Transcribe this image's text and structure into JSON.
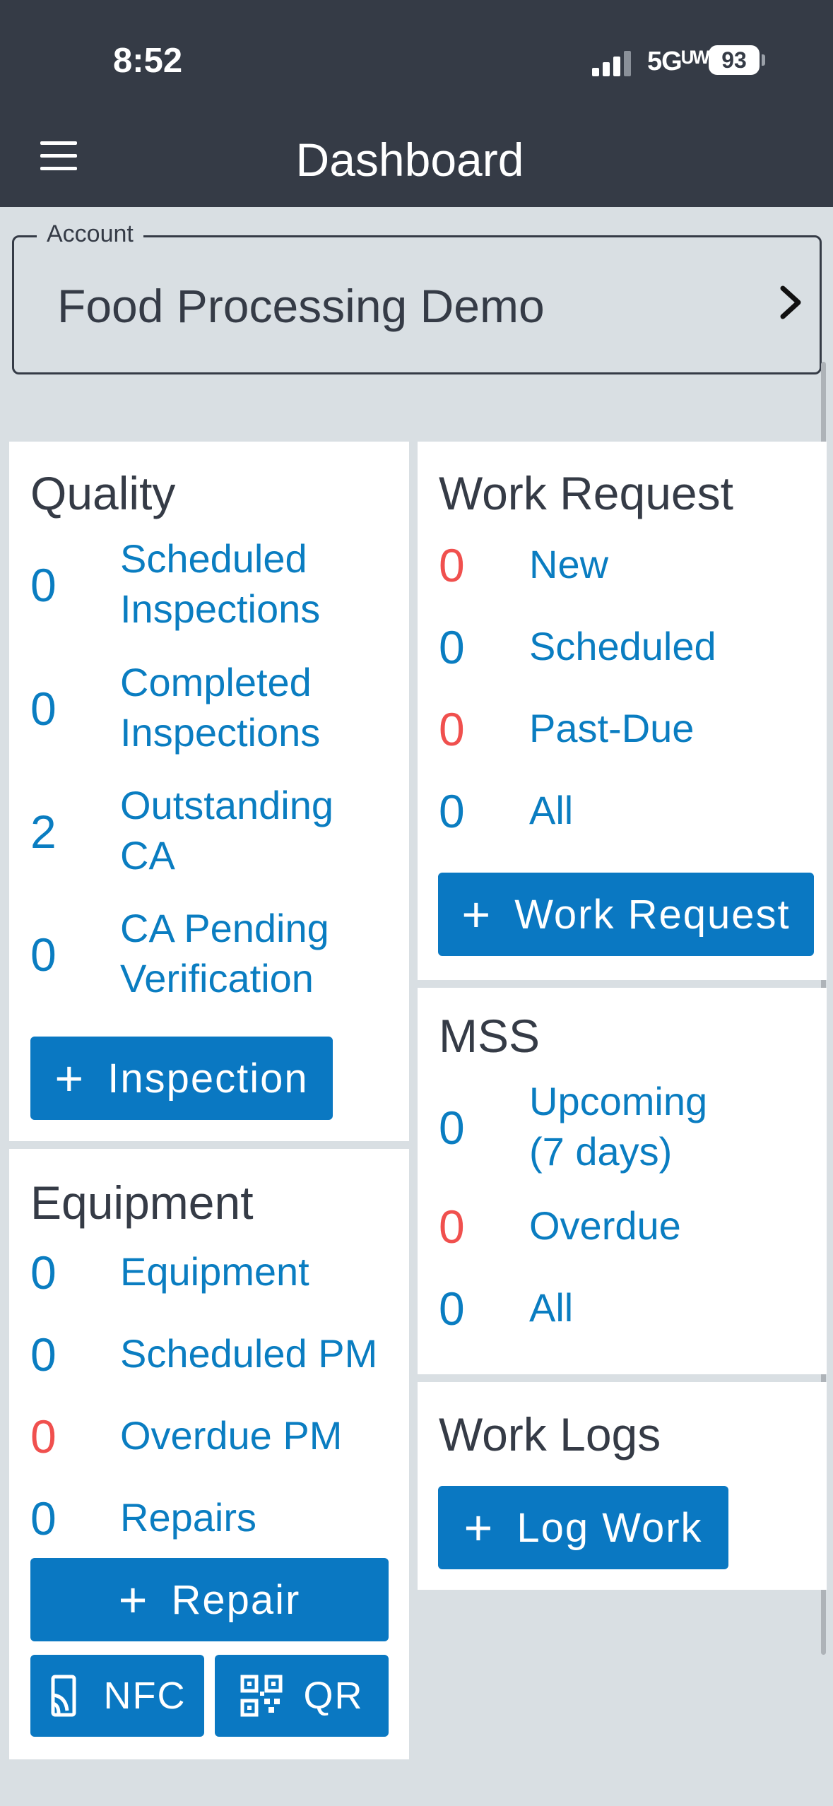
{
  "status_bar": {
    "time": "8:52",
    "network": "5Gᵁᵂ",
    "battery": "93"
  },
  "header": {
    "title": "Dashboard",
    "menu_icon": "hamburger-menu-icon"
  },
  "account": {
    "legend": "Account",
    "name": "Food Processing Demo",
    "icon": "chevron-right-icon"
  },
  "colors": {
    "header_bg": "#353b46",
    "accent": "#0a78c2",
    "link": "#0a7dc1",
    "alert": "#f0504e",
    "page_bg": "#d9dfe3"
  },
  "quality": {
    "title": "Quality",
    "items": [
      {
        "count": "0",
        "line1": "Scheduled",
        "line2": "Inspections",
        "alert": false
      },
      {
        "count": "0",
        "line1": "Completed",
        "line2": "Inspections",
        "alert": false
      },
      {
        "count": "2",
        "line1": "Outstanding",
        "line2": "CA",
        "alert": false
      },
      {
        "count": "0",
        "line1": "CA Pending",
        "line2": "Verification",
        "alert": false
      }
    ],
    "button": "Inspection"
  },
  "equipment": {
    "title": "Equipment",
    "items": [
      {
        "count": "0",
        "label": "Equipment",
        "alert": false
      },
      {
        "count": "0",
        "label": "Scheduled PM",
        "alert": false
      },
      {
        "count": "0",
        "label": "Overdue PM",
        "alert": true
      },
      {
        "count": "0",
        "label": "Repairs",
        "alert": false
      }
    ],
    "button": "Repair",
    "nfc_button": "NFC",
    "qr_button": "QR"
  },
  "work_request": {
    "title": "Work Request",
    "items": [
      {
        "count": "0",
        "label": "New",
        "alert": true
      },
      {
        "count": "0",
        "label": "Scheduled",
        "alert": false
      },
      {
        "count": "0",
        "label": "Past-Due",
        "alert": true
      },
      {
        "count": "0",
        "label": "All",
        "alert": false
      }
    ],
    "button": "Work Request"
  },
  "mss": {
    "title": "MSS",
    "items": [
      {
        "count": "0",
        "line1": "Upcoming",
        "line2": "(7 days)",
        "alert": false
      },
      {
        "count": "0",
        "label": "Overdue",
        "alert": true
      },
      {
        "count": "0",
        "label": "All",
        "alert": false
      }
    ]
  },
  "work_logs": {
    "title": "Work Logs",
    "button": "Log Work"
  }
}
